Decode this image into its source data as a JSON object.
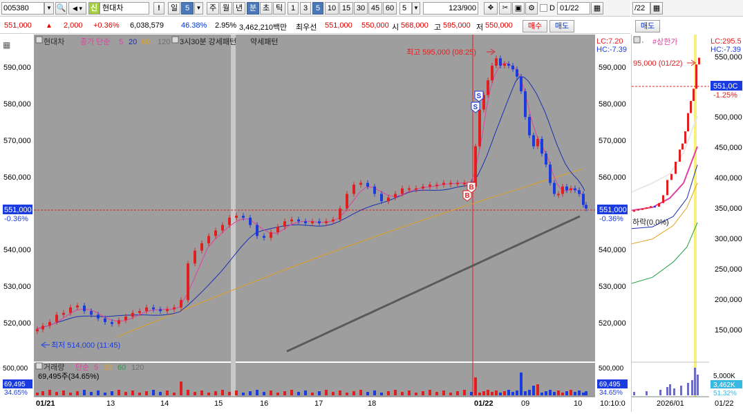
{
  "toolbar": {
    "code": "005380",
    "name": "현대차",
    "sin": "신",
    "bang": "!",
    "period_day": "일",
    "period_num": "5",
    "periods": [
      "주",
      "월",
      "년",
      "분",
      "초",
      "틱"
    ],
    "intervals": [
      "1",
      "3",
      "5",
      "10",
      "15",
      "30",
      "45",
      "60"
    ],
    "interval_input": "5",
    "count": "123",
    "count_max": "/900",
    "d_label": "D",
    "date": "01/22"
  },
  "toolbar2": {
    "date": "/22"
  },
  "quote": {
    "price": "551,000",
    "change": "2,000",
    "change_pct": "+0.36%",
    "volume": "6,038,579",
    "vol_ratio": "46.38%",
    "turnover": "2.95%",
    "amount": "3,462,210백만",
    "best_label": "최우선",
    "best_ask": "551,000",
    "best_bid": "550,000",
    "open_label": "시",
    "open": "568,000",
    "high_label": "고",
    "high": "595,000",
    "low_label": "저",
    "low": "550,000",
    "buy_btn": "매수",
    "sell_btn": "매도",
    "sell_btn2": "매도"
  },
  "main_chart": {
    "legend_name": "현대차",
    "legend_ma": "종가 단순",
    "ma_periods": [
      "5",
      "20",
      "60",
      "120"
    ],
    "pattern_label": "3시30분 강세패턴",
    "weak_label": "약세패턴",
    "lc_label": "LC:7.20",
    "hc_label": "HC:-7.39",
    "high_annot": "최고 595,000 (08:25)",
    "low_annot": "최저 514,000 (11:45)",
    "price_ticks": [
      "590,000",
      "580,000",
      "570,000",
      "560,000",
      "540,000",
      "530,000",
      "520,000"
    ],
    "current_price_tag": "551,000",
    "current_pct_tag": "-0.36%",
    "left_price_tag": "551,000",
    "left_pct_tag": "-0.36%",
    "vol_legend_name": "거래량",
    "vol_legend_ma": "단순",
    "vol_ma_periods": [
      "5",
      "20",
      "60",
      "120"
    ],
    "vol_value": "69,495주(34.65%)",
    "vol_tick": "500,000",
    "vol_left_tag": "69,495",
    "vol_left_pct": "34.65%",
    "vol_right_tag": "69,495",
    "vol_right_pct": "34.65%",
    "x_labels": [
      "01/21",
      "13",
      "14",
      "15",
      "16",
      "17",
      "18",
      "01/22",
      "09",
      "10"
    ],
    "time_label": "10:10:0",
    "signal_s": "S",
    "signal_b": "B"
  },
  "right_chart": {
    "legend_name": "#상한가",
    "lc_label": "LC:295.5",
    "hc_label": "HC:-7.39",
    "annot": "95,000 (01/22)",
    "down_label": "하락(0.0%)",
    "price_ticks": [
      "550,000",
      "500,000",
      "450,000",
      "400,000",
      "350,000",
      "300,000",
      "250,000",
      "200,000",
      "150,000"
    ],
    "price_tag": "551,0C",
    "pct_tag": "-1.25%",
    "vol_tick": "5,000K",
    "vol_tag": "3,462K",
    "vol_pct": "51.32%",
    "x_labels": [
      "2026/01",
      "01/22"
    ]
  },
  "colors": {
    "up": "#e02020",
    "down": "#1a3be0",
    "ma5": "#e040a0",
    "ma20": "#1a2fb0",
    "ma60": "#e0a020",
    "ma120": "#707070",
    "plot_bg": "#9e9e9e"
  },
  "chart_data": {
    "type": "candlestick",
    "price_range": [
      511000,
      597000
    ],
    "current_price": 551000,
    "high": 595000,
    "low": 514000
  }
}
